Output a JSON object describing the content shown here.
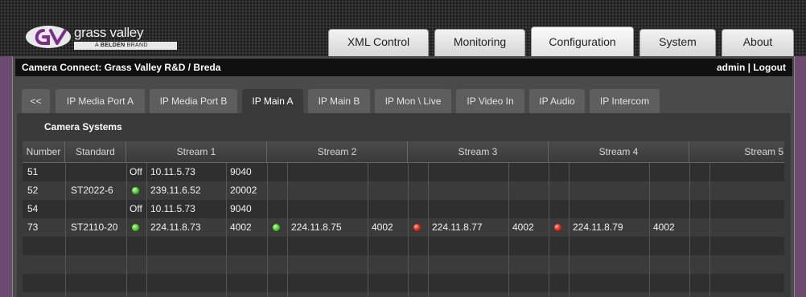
{
  "logo": {
    "name": "grass valley",
    "brand_prefix": "A",
    "brand_name": "BELDEN",
    "brand_suffix": "BRAND"
  },
  "top_tabs": [
    "XML Control",
    "Monitoring",
    "Configuration",
    "System",
    "About"
  ],
  "active_top_tab": "Configuration",
  "header": {
    "title": "Camera Connect: Grass Valley R&D / Breda",
    "user": "admin | Logout"
  },
  "sub_tabs": [
    "<<",
    "IP Media Port A",
    "IP Media Port B",
    "IP Main A",
    "IP Main B",
    "IP Mon \\ Live",
    "IP Video In",
    "IP Audio",
    "IP Intercom"
  ],
  "active_sub_tab": "IP Main A",
  "panel_title": "Camera Systems",
  "columns": [
    "Number",
    "Standard",
    "Stream 1",
    "Stream 2",
    "Stream 3",
    "Stream 4",
    "Stream 5"
  ],
  "rows": [
    {
      "number": "51",
      "standard": "",
      "streams": [
        {
          "status": "Off",
          "ip": "10.11.5.73",
          "port": "9040"
        },
        {
          "status": "",
          "ip": "",
          "port": ""
        },
        {
          "status": "",
          "ip": "",
          "port": ""
        },
        {
          "status": "",
          "ip": "",
          "port": ""
        }
      ]
    },
    {
      "number": "52",
      "standard": "ST2022-6",
      "streams": [
        {
          "status": "green",
          "ip": "239.11.6.52",
          "port": "20002"
        },
        {
          "status": "",
          "ip": "",
          "port": ""
        },
        {
          "status": "",
          "ip": "",
          "port": ""
        },
        {
          "status": "",
          "ip": "",
          "port": ""
        }
      ]
    },
    {
      "number": "54",
      "standard": "",
      "streams": [
        {
          "status": "Off",
          "ip": "10.11.5.73",
          "port": "9040"
        },
        {
          "status": "",
          "ip": "",
          "port": ""
        },
        {
          "status": "",
          "ip": "",
          "port": ""
        },
        {
          "status": "",
          "ip": "",
          "port": ""
        }
      ]
    },
    {
      "number": "73",
      "standard": "ST2110-20",
      "streams": [
        {
          "status": "green",
          "ip": "224.11.8.73",
          "port": "4002"
        },
        {
          "status": "green",
          "ip": "224.11.8.75",
          "port": "4002"
        },
        {
          "status": "red",
          "ip": "224.11.8.77",
          "port": "4002"
        },
        {
          "status": "red",
          "ip": "224.11.8.79",
          "port": "4002"
        }
      ]
    }
  ],
  "colors": {
    "accent": "#6d4a6f",
    "status_green": "#4fd42a",
    "status_red": "#ee2a1e"
  }
}
